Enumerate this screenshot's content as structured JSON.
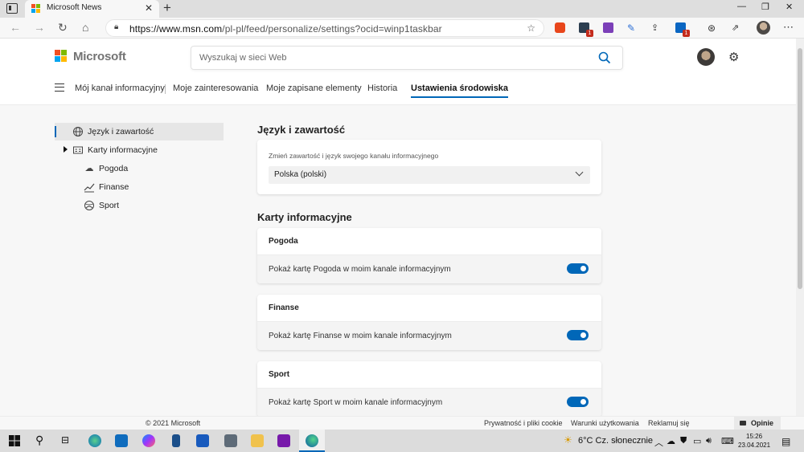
{
  "browser": {
    "tab_title": "Microsoft News",
    "url_domain": "https://www.msn.com",
    "url_path": "/pl-pl/feed/personalize/settings?ocid=winp1taskbar",
    "ext_badge_1": "1",
    "ext_badge_2": "1"
  },
  "header": {
    "brand": "Microsoft",
    "search_placeholder": "Wyszukaj w sieci Web"
  },
  "nav": {
    "items": [
      "Mój kanał informacyjny",
      "Moje zainteresowania",
      "Moje zapisane elementy",
      "Historia",
      "Ustawienia środowiska"
    ],
    "active_index": 4
  },
  "sidebar": {
    "items": [
      {
        "label": "Język i zawartość",
        "icon": "globe-icon"
      },
      {
        "label": "Karty informacyjne",
        "icon": "cards-icon"
      },
      {
        "label": "Pogoda",
        "icon": "weather-icon"
      },
      {
        "label": "Finanse",
        "icon": "finance-icon"
      },
      {
        "label": "Sport",
        "icon": "sport-icon"
      }
    ]
  },
  "language_section": {
    "title": "Język i zawartość",
    "hint": "Zmień zawartość i język swojego kanału informacyjnego",
    "selected": "Polska (polski)"
  },
  "cards_section": {
    "title": "Karty informacyjne",
    "cards": [
      {
        "title": "Pogoda",
        "label": "Pokaż kartę Pogoda w moim kanale informacyjnym",
        "enabled": true
      },
      {
        "title": "Finanse",
        "label": "Pokaż kartę Finanse w moim kanale informacyjnym",
        "enabled": true
      },
      {
        "title": "Sport",
        "label": "Pokaż kartę Sport w moim kanale informacyjnym",
        "enabled": true
      }
    ]
  },
  "footer": {
    "copyright": "© 2021 Microsoft",
    "privacy": "Prywatność i pliki cookie",
    "terms": "Warunki użytkowania",
    "ads": "Reklamuj się",
    "feedback": "Opinie"
  },
  "taskbar": {
    "weather": "6°C  Cz. słonecznie",
    "time": "15:26",
    "date": "23.04.2021"
  },
  "colors": {
    "accent": "#0067b8",
    "ms_red": "#f25022",
    "ms_green": "#7fba00",
    "ms_blue": "#00a4ef",
    "ms_yellow": "#ffb900"
  }
}
